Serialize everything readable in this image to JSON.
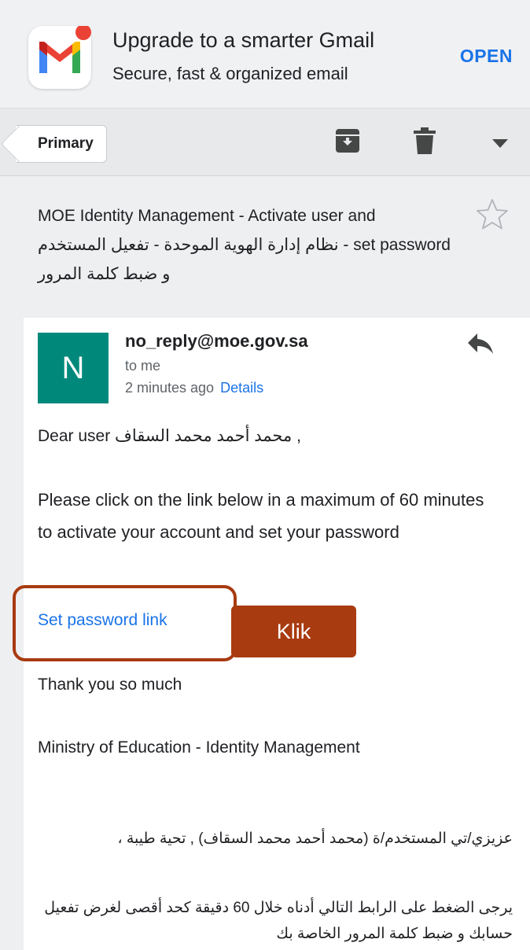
{
  "banner": {
    "title": "Upgrade to a smarter Gmail",
    "subtitle": "Secure, fast & organized email",
    "open_label": "OPEN",
    "app_icon": "gmail-logo-icon"
  },
  "toolbar": {
    "label": "Primary",
    "icons": [
      "archive-icon",
      "trash-icon",
      "more-dropdown-icon"
    ]
  },
  "subject": {
    "line1": "MOE Identity Management - Activate user and",
    "line2": "set password - نظام إدارة الهوية الموحدة - تفعيل المستخدم",
    "line3": "و ضبط كلمة المرور"
  },
  "message": {
    "avatar_letter": "N",
    "avatar_color": "#00897b",
    "sender": "no_reply@moe.gov.sa",
    "to": "to me",
    "time": "2 minutes ago",
    "details_label": "Details",
    "greeting": "Dear user محمد أحمد محمد السقاف ,",
    "instruction": "Please click on the link below in a maximum of 60 minutes to activate your account and set your password",
    "link_label": "Set password link",
    "thanks": "Thank you so much",
    "signature": "Ministry of Education - Identity Management",
    "ar_greeting": "عزيزي/تي المستخدم/ة (محمد أحمد محمد السقاف) , تحية طيبة ،",
    "ar_instruction": "يرجى الضغط على الرابط التالي أدناه خلال 60 دقيقة كحد أقصى لغرض تفعيل حسابك و ضبط كلمة المرور الخاصة بك"
  },
  "annotation": {
    "label": "Klik",
    "color": "#a83b10"
  },
  "colors": {
    "link": "#1a73e8",
    "text": "#202124",
    "muted": "#5f6368"
  }
}
